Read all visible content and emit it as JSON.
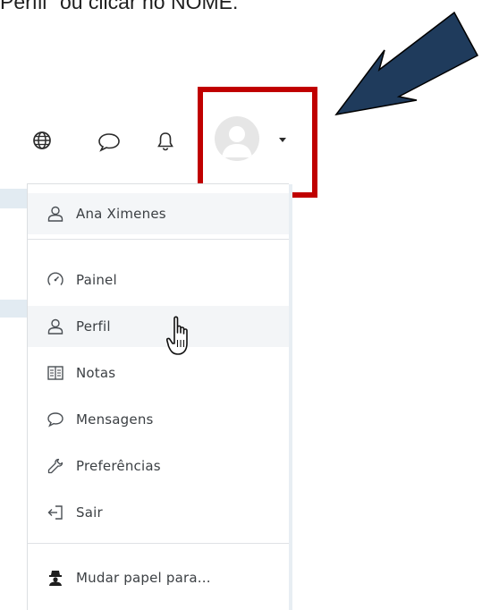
{
  "caption": "Perfil\" ou clicar no NOME.",
  "navbar": {
    "icons": [
      "globe-icon",
      "chat-icon",
      "bell-icon",
      "avatar",
      "chevron-down-icon"
    ]
  },
  "user_menu": {
    "user_name": "Ana Ximenes",
    "items": [
      {
        "label": "Painel",
        "icon": "gauge-icon"
      },
      {
        "label": "Perfil",
        "icon": "user-icon"
      },
      {
        "label": "Notas",
        "icon": "grades-icon"
      },
      {
        "label": "Mensagens",
        "icon": "chat-icon"
      },
      {
        "label": "Preferências",
        "icon": "wrench-icon"
      },
      {
        "label": "Sair",
        "icon": "logout-icon"
      }
    ],
    "switch_role": {
      "label": "Mudar papel para...",
      "icon": "user-secret-icon"
    }
  },
  "colors": {
    "highlight": "#c00000",
    "arrow_fill": "#1f3b5c"
  }
}
